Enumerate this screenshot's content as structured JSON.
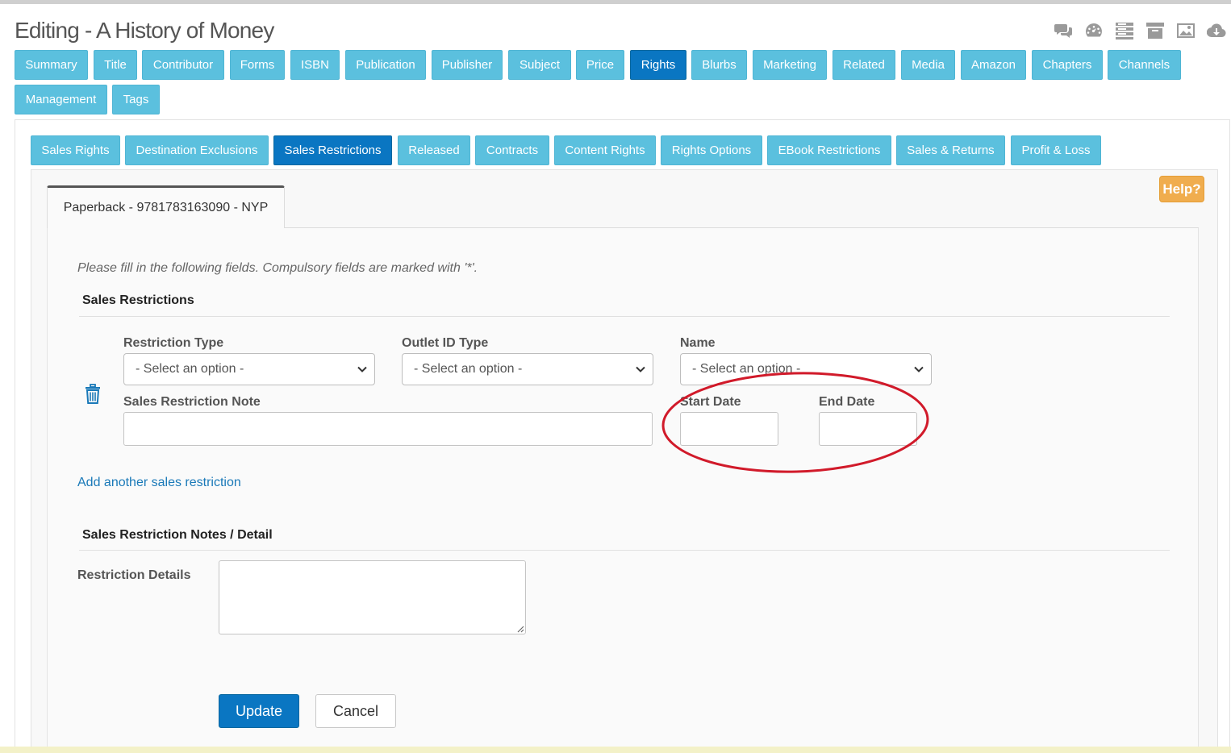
{
  "page": {
    "title": "Editing - A History of Money"
  },
  "toolbar_icons": [
    "chat-icon",
    "dashboard-icon",
    "list-icon",
    "archive-icon",
    "image-icon",
    "cloud-download-icon"
  ],
  "main_tabs": [
    {
      "label": "Summary"
    },
    {
      "label": "Title"
    },
    {
      "label": "Contributor"
    },
    {
      "label": "Forms"
    },
    {
      "label": "ISBN"
    },
    {
      "label": "Publication"
    },
    {
      "label": "Publisher"
    },
    {
      "label": "Subject"
    },
    {
      "label": "Price"
    },
    {
      "label": "Rights",
      "active": true
    },
    {
      "label": "Blurbs"
    },
    {
      "label": "Marketing"
    },
    {
      "label": "Related"
    },
    {
      "label": "Media"
    },
    {
      "label": "Amazon"
    },
    {
      "label": "Chapters"
    },
    {
      "label": "Channels"
    },
    {
      "label": "Management"
    },
    {
      "label": "Tags"
    }
  ],
  "sub_tabs": [
    {
      "label": "Sales Rights"
    },
    {
      "label": "Destination Exclusions"
    },
    {
      "label": "Sales Restrictions",
      "active": true
    },
    {
      "label": "Released"
    },
    {
      "label": "Contracts"
    },
    {
      "label": "Content Rights"
    },
    {
      "label": "Rights Options"
    },
    {
      "label": "EBook Restrictions"
    },
    {
      "label": "Sales & Returns"
    },
    {
      "label": "Profit & Loss"
    }
  ],
  "help_label": "Help?",
  "edition_tab": "Paperback - 9781783163090 - NYP",
  "form": {
    "instructions": "Please fill in the following fields. Compulsory fields are marked with '*'.",
    "section1_title": "Sales Restrictions",
    "restriction_type_label": "Restriction Type",
    "restriction_type_value": "- Select an option -",
    "outlet_id_type_label": "Outlet ID Type",
    "outlet_id_type_value": "- Select an option -",
    "name_label": "Name",
    "name_value": "- Select an option -",
    "note_label": "Sales Restriction Note",
    "note_value": "",
    "start_date_label": "Start Date",
    "start_date_value": "",
    "end_date_label": "End Date",
    "end_date_value": "",
    "add_link": "Add another sales restriction",
    "section2_title": "Sales Restriction Notes / Detail",
    "details_label": "Restriction Details",
    "details_value": ""
  },
  "buttons": {
    "update": "Update",
    "cancel": "Cancel"
  },
  "colors": {
    "tab": "#5bc0de",
    "tab_active": "#0a76c2",
    "help": "#f0ad4e",
    "annotation": "#d11a2a"
  }
}
